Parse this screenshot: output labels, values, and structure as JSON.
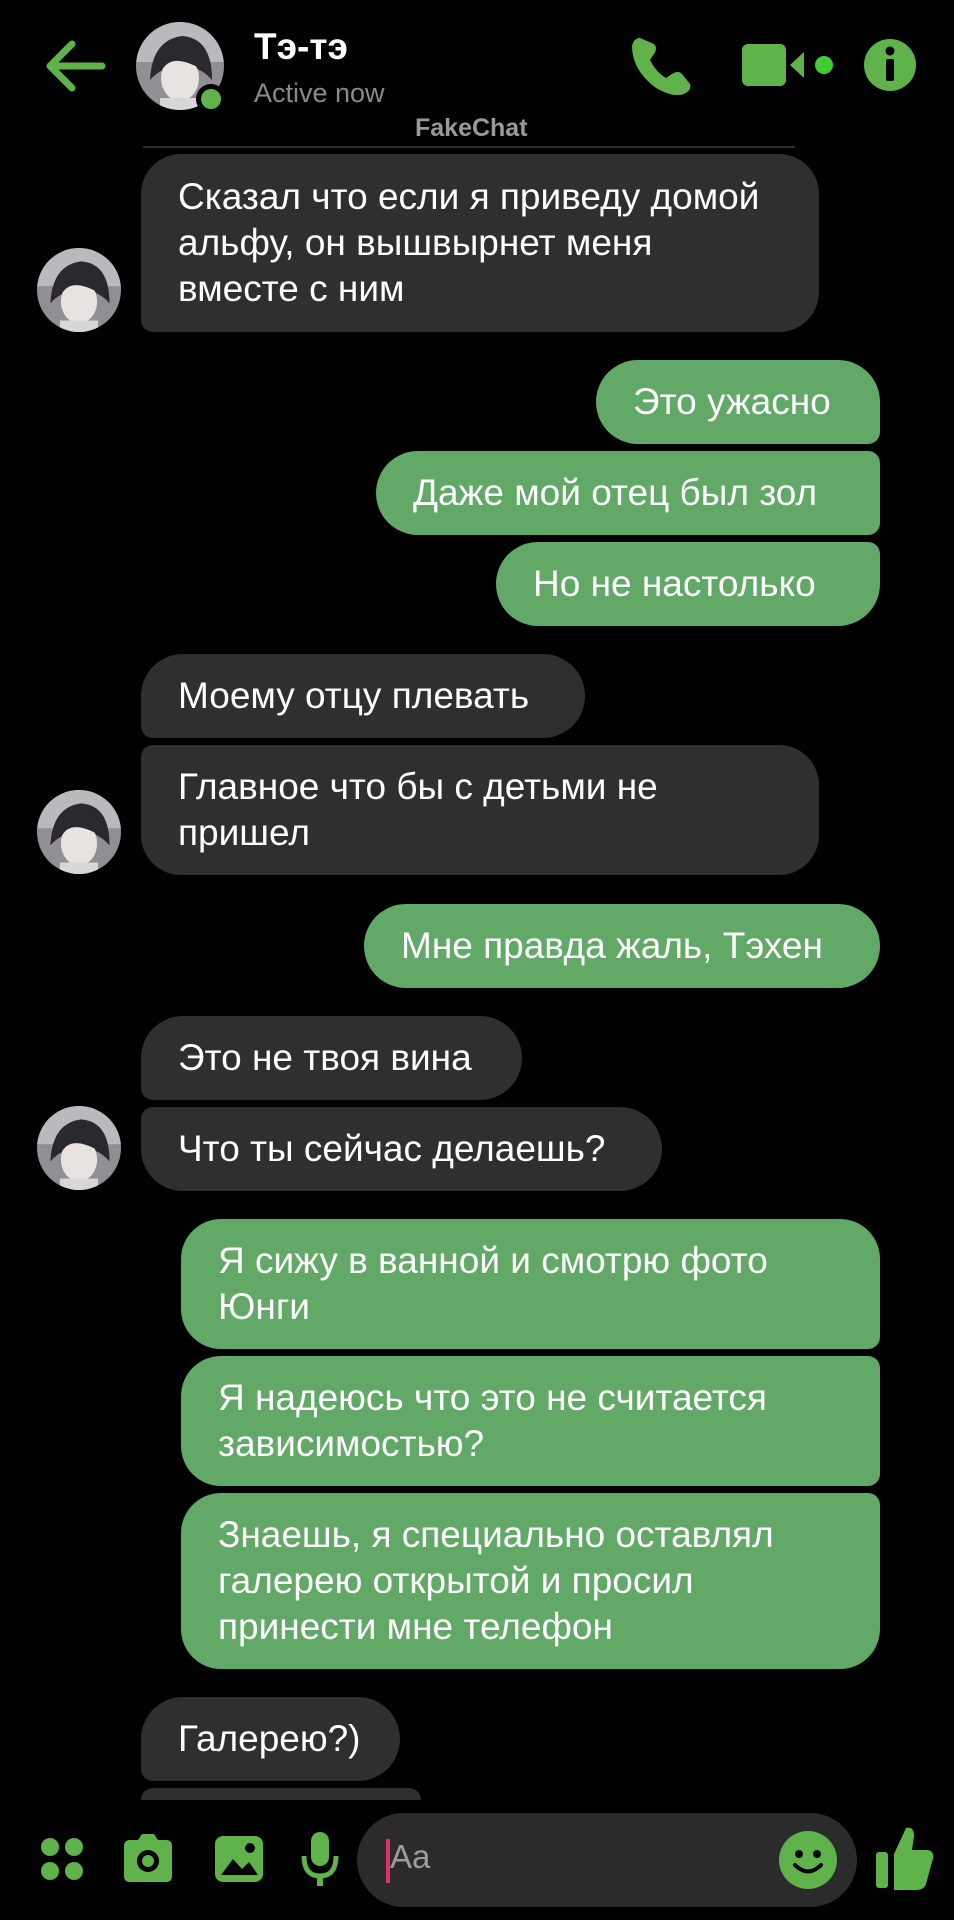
{
  "header": {
    "contact_name": "Тэ-тэ",
    "status": "Active now",
    "watermark": "FakeChat",
    "accent": "#5fb34a"
  },
  "icons": [
    "back-arrow-icon",
    "phone-icon",
    "video-camera-icon",
    "info-icon",
    "apps-grid-icon",
    "camera-icon",
    "gallery-icon",
    "microphone-icon",
    "emoji-icon",
    "thumbs-up-icon"
  ],
  "messages": [
    {
      "from": "them",
      "text": "Сказал что если я приведу домой альфу, он вышвырнет меня вместе с ним"
    },
    {
      "from": "me",
      "text": "Это ужасно"
    },
    {
      "from": "me",
      "text": "Даже мой отец был зол"
    },
    {
      "from": "me",
      "text": "Но не настолько"
    },
    {
      "from": "them",
      "text": "Моему отцу плевать"
    },
    {
      "from": "them",
      "text": "Главное что бы с детьми не пришел"
    },
    {
      "from": "me",
      "text": "Мне правда жаль, Тэхен"
    },
    {
      "from": "them",
      "text": "Это не твоя вина"
    },
    {
      "from": "them",
      "text": "Что ты сейчас делаешь?"
    },
    {
      "from": "me",
      "text": "Я сижу в ванной и смотрю фото Юнги"
    },
    {
      "from": "me",
      "text": "Я надеюсь что это не считается зависимостью?"
    },
    {
      "from": "me",
      "text": "Знаешь, я специально оставлял галерею открытой и просил принести мне телефон"
    },
    {
      "from": "them",
      "text": "Галерею?)"
    }
  ],
  "composer": {
    "placeholder": "Aa"
  },
  "colors": {
    "outgoing_bubble": "#62a967",
    "incoming_bubble": "#2f2f2f",
    "background": "#000000"
  }
}
